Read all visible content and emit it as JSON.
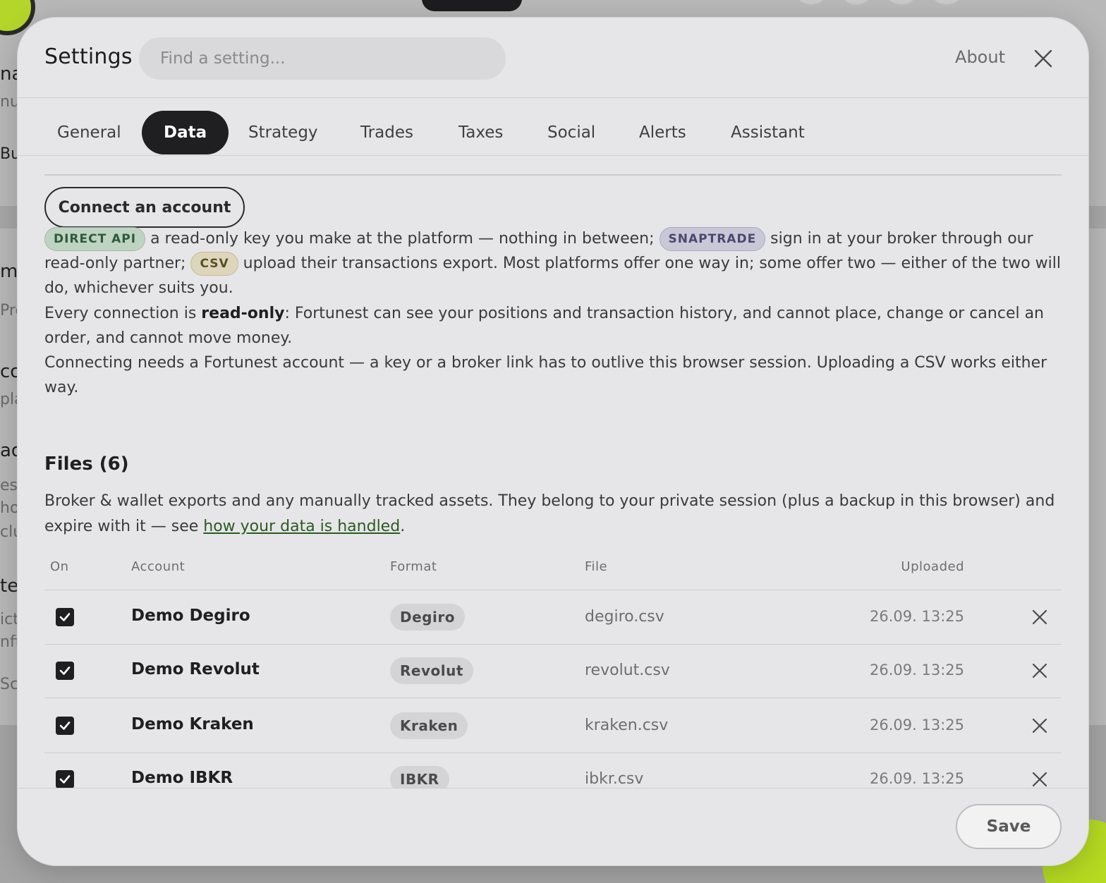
{
  "background": {
    "fragments": [
      "na",
      "nul",
      "Bu",
      "mu",
      "Pro",
      "co",
      "pla",
      "ad",
      "es",
      "ho",
      "clu",
      "ter",
      "ict",
      "nfi",
      "Sc"
    ]
  },
  "dialog": {
    "title": "Settings",
    "search_placeholder": "Find a setting...",
    "about_label": "About",
    "tabs": [
      {
        "label": "General",
        "active": false
      },
      {
        "label": "Data",
        "active": true
      },
      {
        "label": "Strategy",
        "active": false
      },
      {
        "label": "Trades",
        "active": false
      },
      {
        "label": "Taxes",
        "active": false
      },
      {
        "label": "Social",
        "active": false
      },
      {
        "label": "Alerts",
        "active": false
      },
      {
        "label": "Assistant",
        "active": false
      }
    ]
  },
  "connect": {
    "button_label": "Connect an account",
    "badge_api": "DIRECT API",
    "text_api": " a read-only key you make at the platform — nothing in between; ",
    "badge_snaptrade": "SNAPTRADE",
    "text_snaptrade": " sign in at your broker through our read-only partner; ",
    "badge_csv": "CSV",
    "text_csv": " upload their transactions export. Most platforms offer one way in; some offer two — either of the two will do, whichever suits you.",
    "readonly_prefix": "Every connection is ",
    "readonly_bold": "read-only",
    "readonly_suffix": ": Fortunest can see your positions and transaction history, and cannot place, change or cancel an order, and cannot move money.",
    "account_note": "Connecting needs a Fortunest account — a key or a broker link has to outlive this browser session. Uploading a CSV works either way."
  },
  "files": {
    "title": "Files (6)",
    "desc_prefix": "Broker & wallet exports and any manually tracked assets. They belong to your private session (plus a backup in this browser) and expire with it — see ",
    "desc_link": "how your data is handled",
    "desc_suffix": ".",
    "columns": {
      "on": "On",
      "account": "Account",
      "format": "Format",
      "file": "File",
      "uploaded": "Uploaded"
    },
    "rows": [
      {
        "on": true,
        "account": "Demo Degiro",
        "format": "Degiro",
        "file": "degiro.csv",
        "uploaded": "26.09. 13:25"
      },
      {
        "on": true,
        "account": "Demo Revolut",
        "format": "Revolut",
        "file": "revolut.csv",
        "uploaded": "26.09. 13:25"
      },
      {
        "on": true,
        "account": "Demo Kraken",
        "format": "Kraken",
        "file": "kraken.csv",
        "uploaded": "26.09. 13:25"
      },
      {
        "on": true,
        "account": "Demo IBKR",
        "format": "IBKR",
        "file": "ibkr.csv",
        "uploaded": "26.09. 13:25"
      }
    ]
  },
  "footer": {
    "save_label": "Save"
  }
}
